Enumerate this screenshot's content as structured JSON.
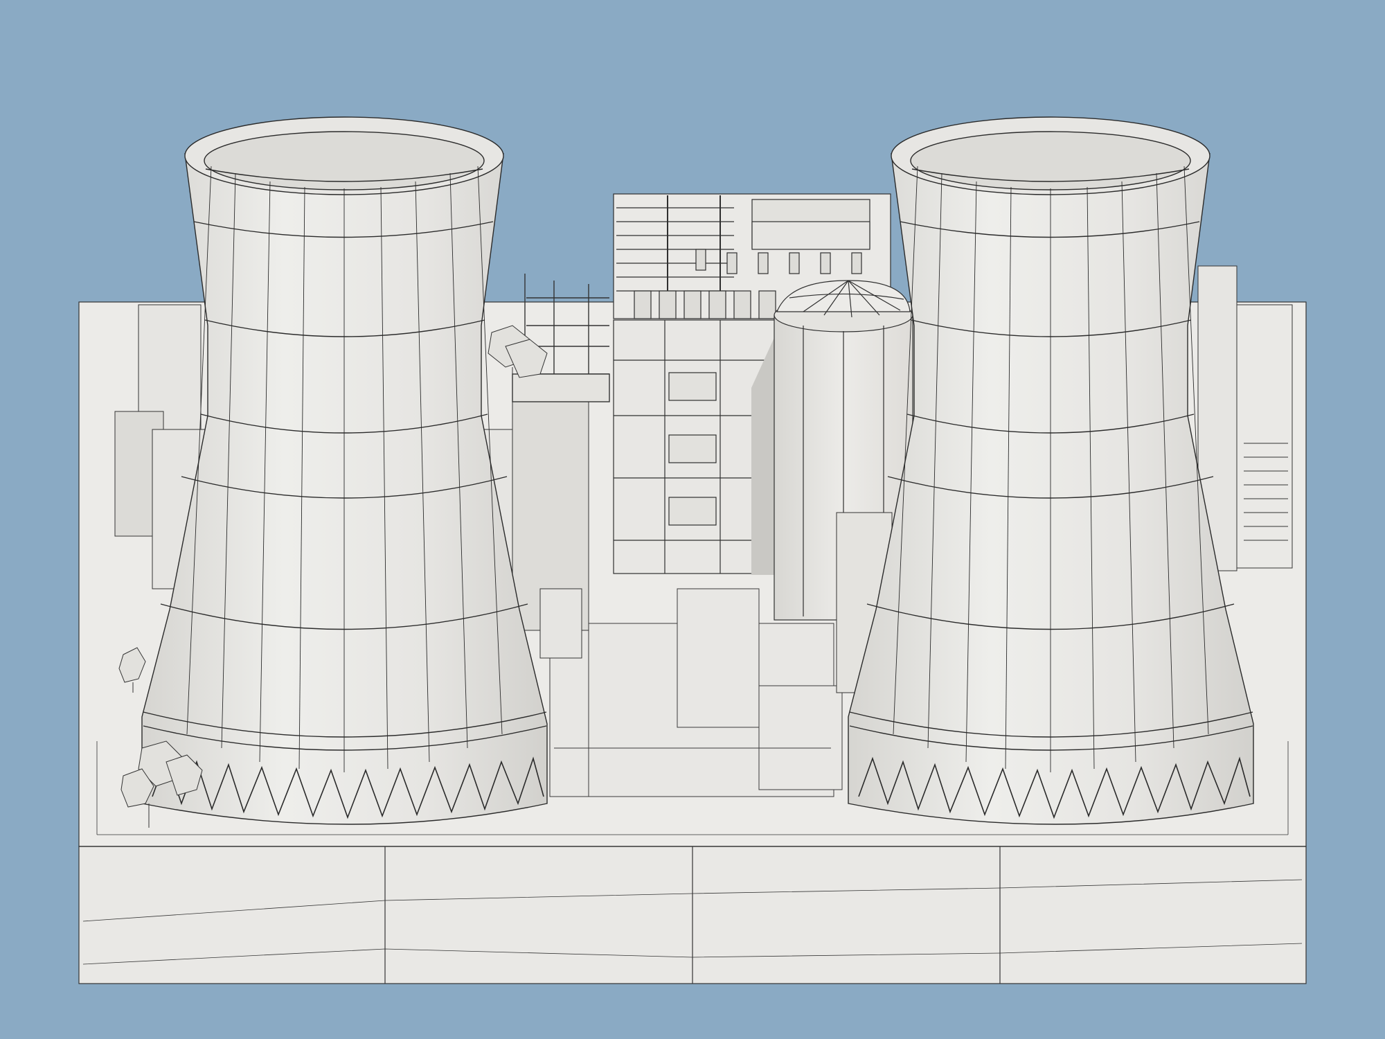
{
  "scene": {
    "subject": "nuclear-power-plant-model",
    "render_style": "clay wireframe",
    "colors": {
      "background": "#8aaac4",
      "model_light": "#ecebe8",
      "model_mid": "#e2e1dd",
      "model_shade": "#d4d3cf",
      "edge": "#2b2b2b",
      "shadow": "#c7c6c2"
    },
    "objects": [
      "cooling-tower-left",
      "cooling-tower-right",
      "reactor-containment-building",
      "turbine-hall-building",
      "electrical-switchyard",
      "trees",
      "base-platform"
    ]
  }
}
